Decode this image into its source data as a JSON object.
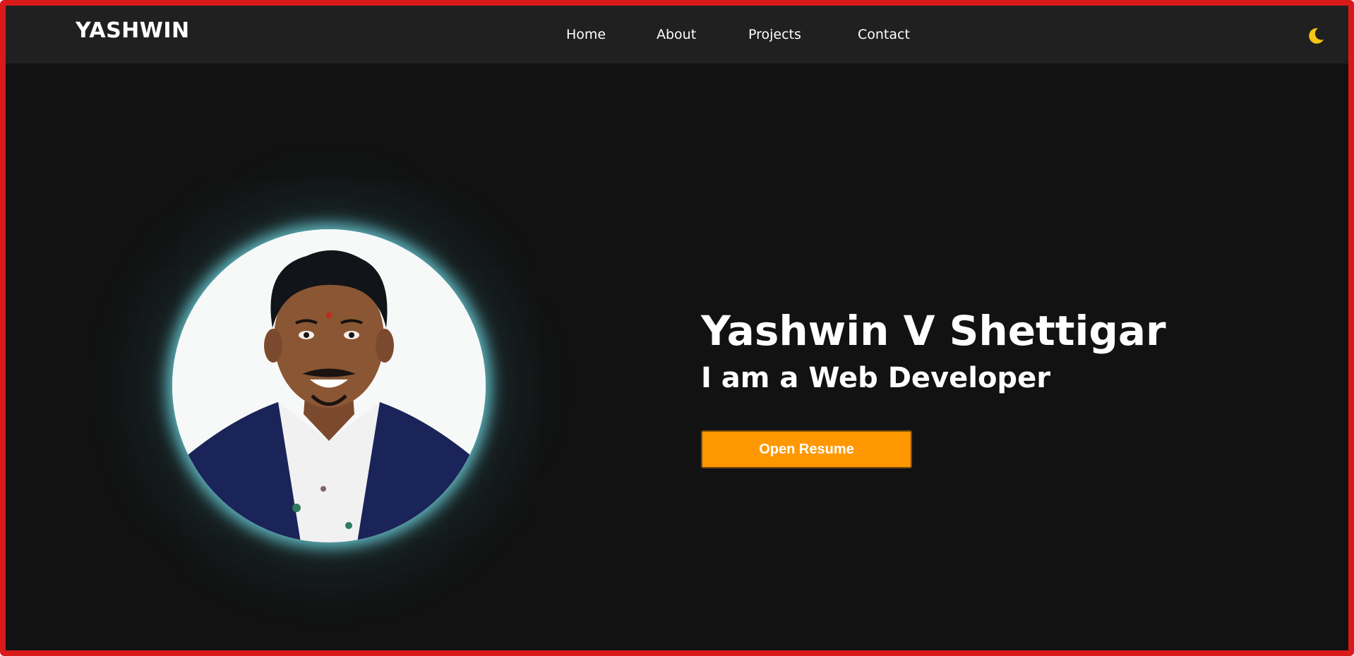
{
  "navbar": {
    "brand": "YASHWIN",
    "links": [
      {
        "label": "Home"
      },
      {
        "label": "About"
      },
      {
        "label": "Projects"
      },
      {
        "label": "Contact"
      }
    ],
    "theme_toggle_icon": "moon-icon",
    "theme_toggle_color": "#f5c518"
  },
  "hero": {
    "name": "Yashwin V Shettigar",
    "tagline": "I am a Web Developer",
    "resume_button_label": "Open Resume",
    "resume_button_color": "#ff9800",
    "profile_image_icon": "profile-photo"
  },
  "colors": {
    "background": "#121212",
    "navbar": "#202020",
    "frame_border": "#d81a1a",
    "glow": "#6ed7e1"
  }
}
